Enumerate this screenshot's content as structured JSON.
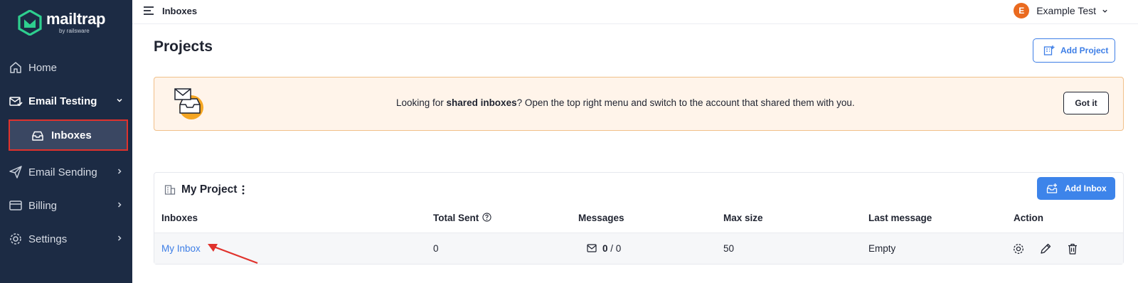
{
  "brand": {
    "name": "mailtrap",
    "sub": "by railsware",
    "color": "#2ecf8f"
  },
  "sidebar": {
    "items": [
      {
        "label": "Home",
        "icon": "home-icon"
      },
      {
        "label": "Email Testing",
        "icon": "email-testing-icon",
        "expanded": true
      },
      {
        "label": "Inboxes",
        "icon": "inbox-icon",
        "active": true
      },
      {
        "label": "Email Sending",
        "icon": "send-icon"
      },
      {
        "label": "Billing",
        "icon": "billing-icon"
      },
      {
        "label": "Settings",
        "icon": "gear-icon"
      }
    ]
  },
  "topbar": {
    "title": "Inboxes",
    "user_initial": "E",
    "user_name": "Example Test"
  },
  "page": {
    "title": "Projects",
    "add_project_label": "Add Project"
  },
  "banner": {
    "text_before": "Looking for ",
    "text_bold": "shared inboxes",
    "text_after": "? Open the top right menu and switch to the account that shared them with you.",
    "button_label": "Got it"
  },
  "project": {
    "name": "My Project",
    "add_inbox_label": "Add Inbox",
    "columns": [
      "Inboxes",
      "Total Sent",
      "Messages",
      "Max size",
      "Last message",
      "Action"
    ],
    "rows": [
      {
        "inbox": "My Inbox",
        "total_sent": "0",
        "messages_unread": "0",
        "messages_sep": " / ",
        "messages_total": "0",
        "max_size": "50",
        "last_message": "Empty"
      }
    ]
  },
  "colors": {
    "sidebar": "#1c2b44",
    "accent": "#3d84ea",
    "highlight": "#e0322c",
    "banner_bg": "#fff4ea"
  }
}
